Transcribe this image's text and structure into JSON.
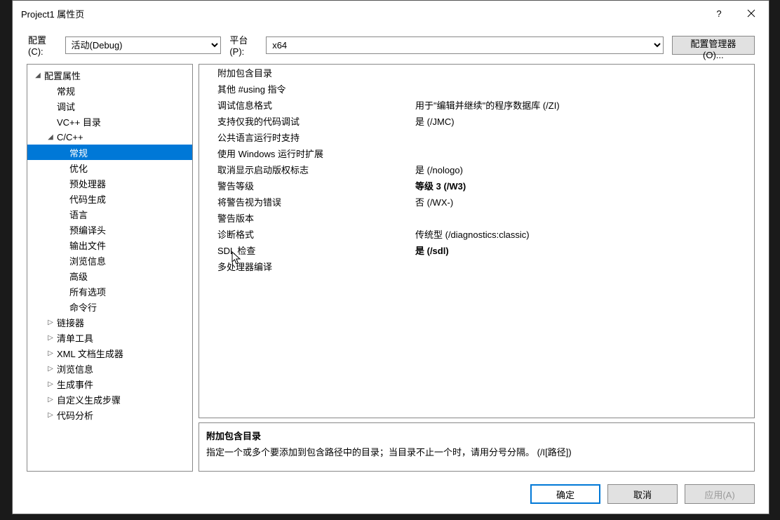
{
  "window": {
    "title": "Project1 属性页",
    "help": "?",
    "close": "×"
  },
  "config": {
    "label_config": "配置(C):",
    "value_config": "活动(Debug)",
    "label_platform": "平台(P):",
    "value_platform": "x64",
    "manager_btn": "配置管理器(O)..."
  },
  "tree": [
    {
      "label": "配置属性",
      "depth": 0,
      "expanded": true
    },
    {
      "label": "常规",
      "depth": 1
    },
    {
      "label": "调试",
      "depth": 1
    },
    {
      "label": "VC++ 目录",
      "depth": 1
    },
    {
      "label": "C/C++",
      "depth": 1,
      "expanded": true
    },
    {
      "label": "常规",
      "depth": 2,
      "selected": true
    },
    {
      "label": "优化",
      "depth": 2
    },
    {
      "label": "预处理器",
      "depth": 2
    },
    {
      "label": "代码生成",
      "depth": 2
    },
    {
      "label": "语言",
      "depth": 2
    },
    {
      "label": "预编译头",
      "depth": 2
    },
    {
      "label": "输出文件",
      "depth": 2
    },
    {
      "label": "浏览信息",
      "depth": 2
    },
    {
      "label": "高级",
      "depth": 2
    },
    {
      "label": "所有选项",
      "depth": 2
    },
    {
      "label": "命令行",
      "depth": 2
    },
    {
      "label": "链接器",
      "depth": 1,
      "expandable": true
    },
    {
      "label": "清单工具",
      "depth": 1,
      "expandable": true
    },
    {
      "label": "XML 文档生成器",
      "depth": 1,
      "expandable": true
    },
    {
      "label": "浏览信息",
      "depth": 1,
      "expandable": true
    },
    {
      "label": "生成事件",
      "depth": 1,
      "expandable": true
    },
    {
      "label": "自定义生成步骤",
      "depth": 1,
      "expandable": true
    },
    {
      "label": "代码分析",
      "depth": 1,
      "expandable": true
    }
  ],
  "props": [
    {
      "name": "附加包含目录",
      "value": ""
    },
    {
      "name": "其他 #using 指令",
      "value": ""
    },
    {
      "name": "调试信息格式",
      "value": "用于\"编辑并继续\"的程序数据库 (/ZI)"
    },
    {
      "name": "支持仅我的代码调试",
      "value": "是 (/JMC)"
    },
    {
      "name": "公共语言运行时支持",
      "value": ""
    },
    {
      "name": "使用 Windows 运行时扩展",
      "value": ""
    },
    {
      "name": "取消显示启动版权标志",
      "value": "是 (/nologo)"
    },
    {
      "name": "警告等级",
      "value": "等级 3 (/W3)",
      "bold": true
    },
    {
      "name": "将警告视为错误",
      "value": "否 (/WX-)"
    },
    {
      "name": "警告版本",
      "value": ""
    },
    {
      "name": "诊断格式",
      "value": "传统型 (/diagnostics:classic)"
    },
    {
      "name": "SDL 检查",
      "value": "是 (/sdl)",
      "bold": true
    },
    {
      "name": "多处理器编译",
      "value": ""
    }
  ],
  "description": {
    "title": "附加包含目录",
    "text": "指定一个或多个要添加到包含路径中的目录；当目录不止一个时，请用分号分隔。     (/I[路径])"
  },
  "footer": {
    "ok": "确定",
    "cancel": "取消",
    "apply": "应用(A)"
  }
}
